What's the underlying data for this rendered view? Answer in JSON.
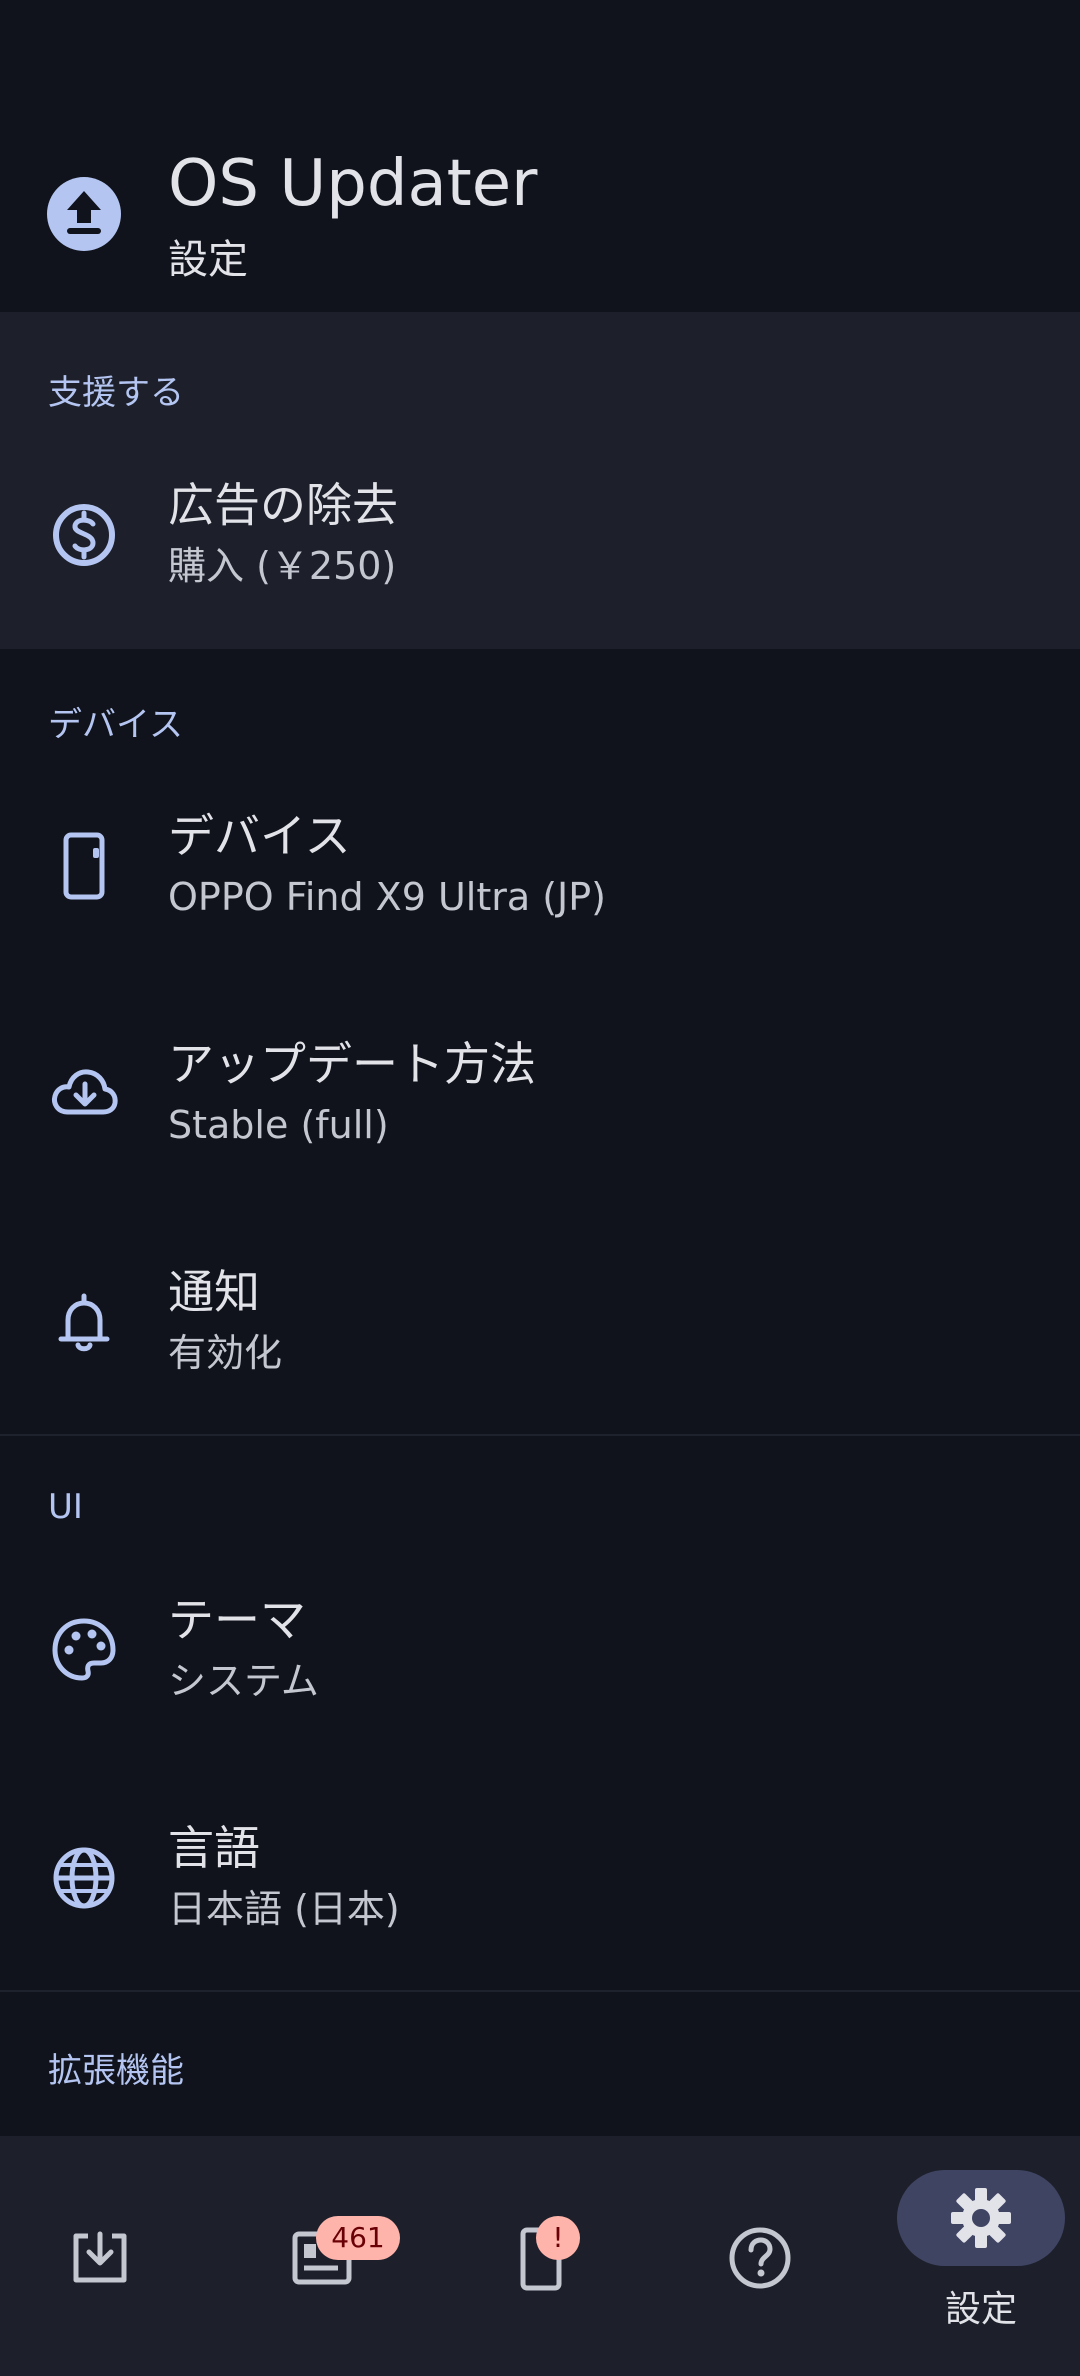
{
  "header": {
    "title": "OS Updater",
    "subtitle": "設定"
  },
  "sections": {
    "support": {
      "label": "支援する",
      "remove_ads": {
        "title": "広告の除去",
        "subtitle": "購入 (￥250)"
      }
    },
    "device": {
      "label": "デバイス",
      "device_row": {
        "title": "デバイス",
        "subtitle": "OPPO Find X9 Ultra (JP)"
      },
      "update_method": {
        "title": "アップデート方法",
        "subtitle": "Stable (full)"
      },
      "notifications": {
        "title": "通知",
        "subtitle": "有効化"
      }
    },
    "ui": {
      "label": "UI",
      "theme": {
        "title": "テーマ",
        "subtitle": "システム"
      },
      "language": {
        "title": "言語",
        "subtitle": "日本語 (日本)"
      }
    },
    "extensions": {
      "label": "拡張機能"
    }
  },
  "bottom_nav": {
    "items": [
      {
        "icon": "download-icon"
      },
      {
        "icon": "news-icon",
        "badge": "461"
      },
      {
        "icon": "device-alert-icon",
        "badge": "!"
      },
      {
        "icon": "help-icon"
      },
      {
        "icon": "gear-icon",
        "label": "設定",
        "active": true
      }
    ]
  },
  "colors": {
    "background": "#10131b",
    "surface": "#1d202a",
    "accent": "#b4c5f2",
    "active_pill": "#3f4463",
    "badge": "#ffb4ab"
  }
}
